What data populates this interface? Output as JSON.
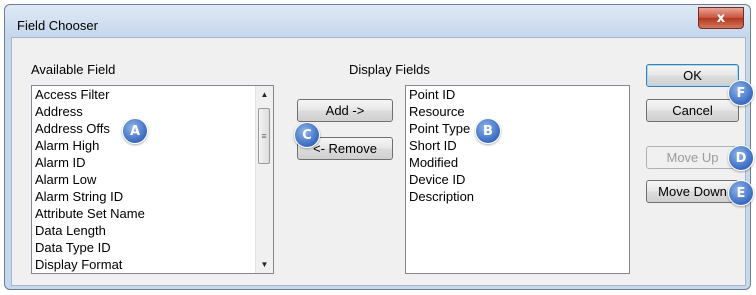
{
  "window": {
    "title": "Field Chooser",
    "close_glyph": "x"
  },
  "available": {
    "label": "Available Field",
    "items": [
      "Access Filter",
      "Address",
      "Address Offs",
      "Alarm High",
      "Alarm ID",
      "Alarm Low",
      "Alarm String ID",
      "Attribute Set Name",
      "Data Length",
      "Data Type ID",
      "Display Format"
    ]
  },
  "display": {
    "label": "Display Fields",
    "items": [
      "Point ID",
      "Resource",
      "Point Type",
      "Short ID",
      "Modified",
      "Device ID",
      "Description"
    ]
  },
  "buttons": {
    "add": "Add ->",
    "remove": "<- Remove",
    "ok": "OK",
    "cancel": "Cancel",
    "move_up": "Move Up",
    "move_down": "Move Down"
  },
  "markers": {
    "a": "A",
    "b": "B",
    "c": "C",
    "d": "D",
    "e": "E",
    "f": "F"
  },
  "icons": {
    "scroll_up": "up-arrow-icon",
    "scroll_down": "down-arrow-icon",
    "thumb_grip": "grip-icon"
  },
  "colors": {
    "marker": "#3f6fc4",
    "close": "#c8513b",
    "frame": "#c6d8ec"
  }
}
